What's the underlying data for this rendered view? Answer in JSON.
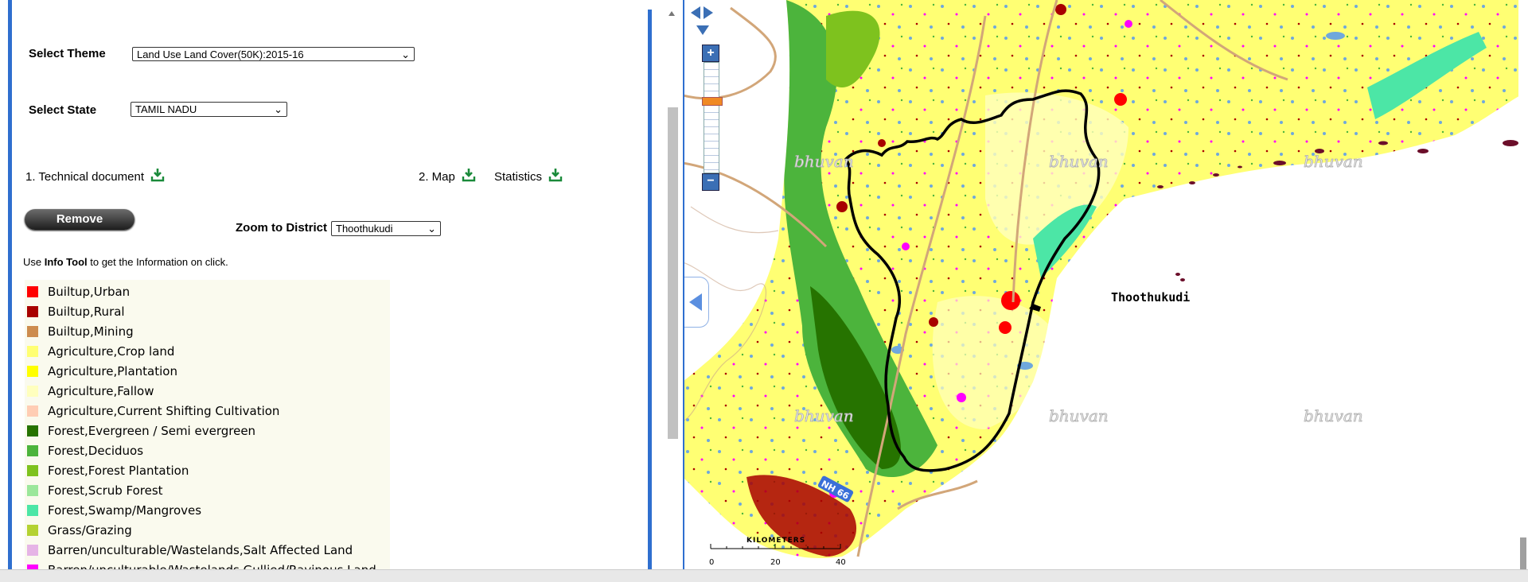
{
  "controls": {
    "theme_label": "Select Theme",
    "theme_value": "Land Use Land Cover(50K):2015-16",
    "state_label": "Select State",
    "state_value": "TAMIL NADU",
    "downloads": {
      "technical_document": "1. Technical document",
      "map": "2. Map",
      "statistics": "Statistics"
    },
    "remove_label": "Remove",
    "zoom_label": "Zoom to District",
    "zoom_value": "Thoothukudi",
    "info_prefix": "Use ",
    "info_tool": "Info Tool",
    "info_suffix": " to get the Information on click."
  },
  "legend": [
    {
      "label": "Builtup,Urban",
      "color": "#ff0000"
    },
    {
      "label": "Builtup,Rural",
      "color": "#a80000"
    },
    {
      "label": "Builtup,Mining",
      "color": "#cd8c4f"
    },
    {
      "label": "Agriculture,Crop land",
      "color": "#ffff73"
    },
    {
      "label": "Agriculture,Plantation",
      "color": "#ffff00"
    },
    {
      "label": "Agriculture,Fallow",
      "color": "#ffffbe"
    },
    {
      "label": "Agriculture,Current Shifting Cultivation",
      "color": "#ffcdb4"
    },
    {
      "label": "Forest,Evergreen / Semi evergreen",
      "color": "#267300"
    },
    {
      "label": "Forest,Deciduos",
      "color": "#4cb43c"
    },
    {
      "label": "Forest,Forest Plantation",
      "color": "#7ec21e"
    },
    {
      "label": "Forest,Scrub Forest",
      "color": "#9be79b"
    },
    {
      "label": "Forest,Swamp/Mangroves",
      "color": "#4ce6a6"
    },
    {
      "label": "Grass/Grazing",
      "color": "#b4d232"
    },
    {
      "label": "Barren/unculturable/Wastelands,Salt Affected Land",
      "color": "#e6b4e6"
    },
    {
      "label": "Barren/unculturable/Wastelands,Gullied/Ravinous Land",
      "color": "#ff00ff"
    }
  ],
  "map": {
    "place_label": "Thoothukudi",
    "watermark": "bhuvan",
    "highway_label": "NH 66",
    "scale_title": "KILOMETERS",
    "scale_ticks": [
      "0",
      "20",
      "40"
    ]
  },
  "colors": {
    "accent_blue": "#2f6fcf",
    "download_green": "#1a8a3a"
  }
}
